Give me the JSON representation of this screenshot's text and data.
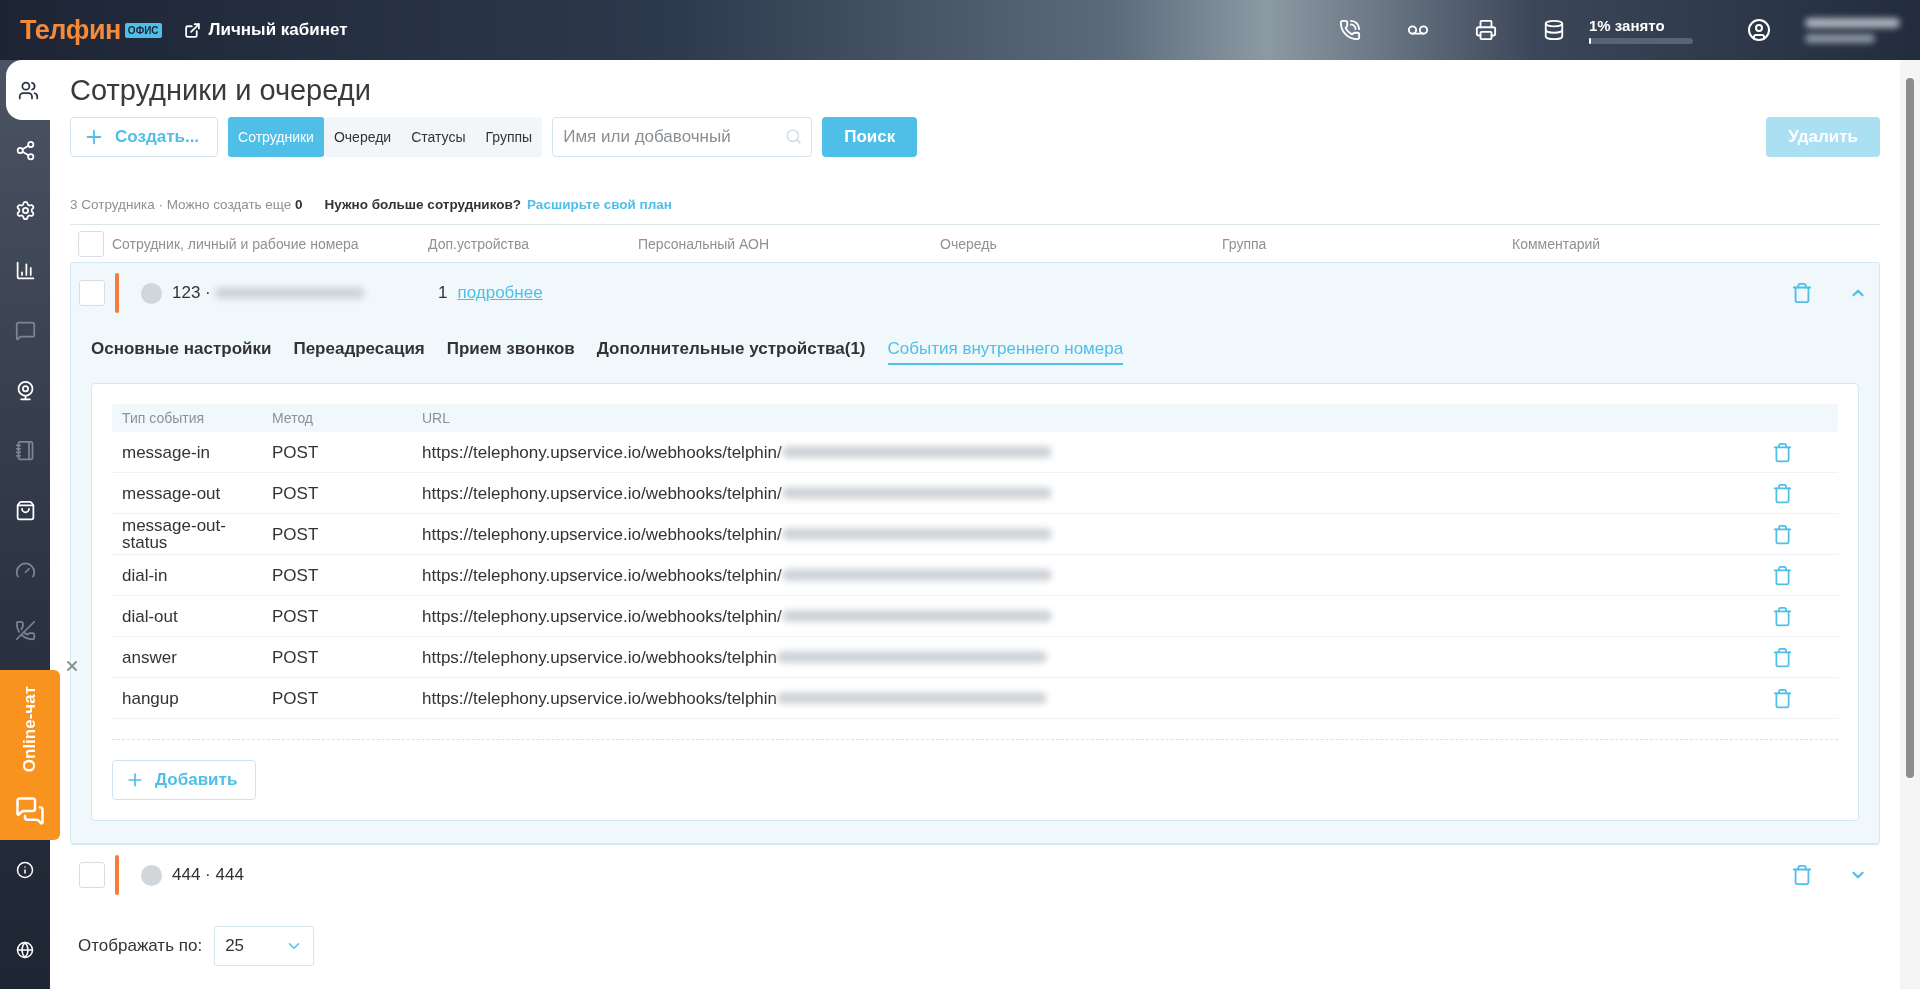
{
  "topbar": {
    "brand": "Телфин",
    "badge": "ОФИС",
    "cabinet_link": "Личный кабинет",
    "storage": {
      "label": "1% занято",
      "level": 0.01
    }
  },
  "sidebar": {
    "items": [
      {
        "selected": true,
        "disabled": false
      },
      {
        "selected": false,
        "disabled": false
      },
      {
        "selected": false,
        "disabled": false
      },
      {
        "selected": false,
        "disabled": false
      },
      {
        "selected": false,
        "disabled": true
      },
      {
        "selected": false,
        "disabled": false
      },
      {
        "selected": false,
        "disabled": true
      },
      {
        "selected": false,
        "disabled": false
      },
      {
        "selected": false,
        "disabled": true
      },
      {
        "selected": false,
        "disabled": true
      },
      {
        "selected": false,
        "disabled": false
      },
      {
        "selected": false,
        "disabled": false
      }
    ]
  },
  "page": {
    "title": "Сотрудники и очереди",
    "create_button": "Создать...",
    "view_tabs": [
      {
        "label": "Сотрудники",
        "selected": true
      },
      {
        "label": "Очереди",
        "selected": false
      },
      {
        "label": "Статусы",
        "selected": false
      },
      {
        "label": "Группы",
        "selected": false
      }
    ],
    "search": {
      "placeholder": "Имя или добавочный"
    },
    "search_button": "Поиск",
    "delete_button": {
      "label": "Удалить",
      "disabled": true
    }
  },
  "summary": {
    "count_text": "3 Сотрудника · Можно создать еще **0**",
    "upsell": "Нужно больше сотрудников?",
    "upgrade_link": "Расширьте свой план"
  },
  "table": {
    "select_all_checked": false,
    "columns": [
      "Сотрудник, личный и рабочие номера",
      "Доп.устройства",
      "Персональный АОН",
      "Очередь",
      "Группа",
      "Комментарий"
    ]
  },
  "employees": [
    {
      "checked": false,
      "number": "123 ·",
      "name_hidden": true,
      "devices": "1",
      "details_link": "подробнее",
      "expanded": true,
      "tabs": [
        {
          "label": "Основные настройки",
          "selected": false
        },
        {
          "label": "Переадресация",
          "selected": false
        },
        {
          "label": "Прием звонков",
          "selected": false
        },
        {
          "label": "Дополнительные устройства(1)",
          "selected": false
        },
        {
          "label": "События внутреннего номера",
          "selected": true
        }
      ],
      "events": {
        "columns": [
          "Тип события",
          "Метод",
          "URL"
        ],
        "rows": [
          {
            "type": "message-in",
            "method": "POST",
            "url": "https://telephony.upservice.io/webhooks/telphin/"
          },
          {
            "type": "message-out",
            "method": "POST",
            "url": "https://telephony.upservice.io/webhooks/telphin/"
          },
          {
            "type": "message-out-status",
            "method": "POST",
            "url": "https://telephony.upservice.io/webhooks/telphin/"
          },
          {
            "type": "dial-in",
            "method": "POST",
            "url": "https://telephony.upservice.io/webhooks/telphin/"
          },
          {
            "type": "dial-out",
            "method": "POST",
            "url": "https://telephony.upservice.io/webhooks/telphin/"
          },
          {
            "type": "answer",
            "method": "POST",
            "url": "https://telephony.upservice.io/webhooks/telphin"
          },
          {
            "type": "hangup",
            "method": "POST",
            "url": "https://telephony.upservice.io/webhooks/telphin"
          }
        ],
        "add_button": "Добавить"
      }
    },
    {
      "checked": false,
      "number": "444 · 444",
      "name_hidden": false,
      "expanded": false
    }
  ],
  "pagination": {
    "label": "Отображать по:",
    "value": "25"
  },
  "chat_widget": {
    "label": "Online-чат"
  }
}
